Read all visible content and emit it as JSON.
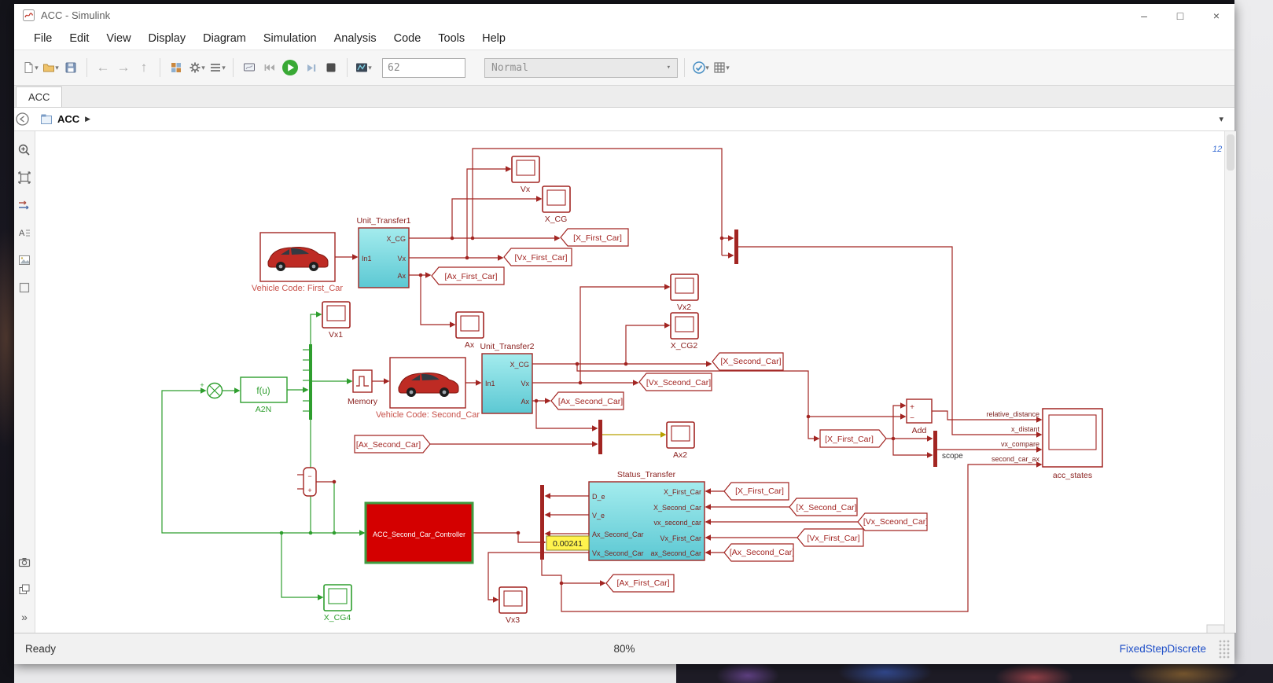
{
  "window": {
    "title": "ACC - Simulink",
    "controls": {
      "minimize": "–",
      "maximize": "□",
      "close": "×"
    }
  },
  "icons": {
    "caret": "▾",
    "crumb_arrow": "▶",
    "chevrons": "»"
  },
  "menu": {
    "items": [
      "File",
      "Edit",
      "View",
      "Display",
      "Diagram",
      "Simulation",
      "Analysis",
      "Code",
      "Tools",
      "Help"
    ]
  },
  "toolbar": {
    "stop_time": "62",
    "sim_mode": "Normal"
  },
  "tabs": {
    "model": "ACC"
  },
  "breadcrumb": {
    "model": "ACC"
  },
  "status": {
    "state": "Ready",
    "zoom": "80%",
    "solver": "FixedStepDiscrete"
  },
  "canvas": {
    "badge": "12"
  },
  "colors": {
    "wire_red": "#a22522",
    "wire_green": "#2e9e2e",
    "block_cyan": "#7adbe0",
    "controller_fill": "#d40000",
    "controller_border": "#3f9b3f",
    "display_yellow": "#fff34d",
    "solver_blue": "#1f4fc8"
  },
  "diagram": {
    "blocks": {
      "unit_transfer1": {
        "title": "Unit_Transfer1",
        "in1": "In1",
        "out1": "X_CG",
        "out2": "Vx",
        "out3": "Ax"
      },
      "unit_transfer2": {
        "title": "Unit_Transfer2",
        "in1": "In1",
        "out1": "X_CG",
        "out2": "Vx",
        "out3": "Ax"
      },
      "status_transfer": {
        "title": "Status_Transfer",
        "in1": "D_e",
        "in2": "V_e",
        "in3": "Ax_Second_Car",
        "in4": "Vx_Second_Car",
        "out1": "X_First_Car",
        "out2": "X_Second_Car",
        "out3": "vx_second_car",
        "out4": "Vx_First_Car",
        "out5": "ax_Second_Car"
      },
      "vehicle1": {
        "label": "Vehicle Code: First_Car"
      },
      "vehicle2": {
        "label": "Vehicle Code: Second_Car"
      },
      "controller": {
        "label": "ACC_Second_Car_Controller"
      },
      "memory": {
        "label": "Memory"
      },
      "fcn": {
        "text": "f(u)",
        "label": "A2N"
      },
      "sum_green": {
        "plus": "+"
      },
      "sum_red": {
        "minus": "−",
        "plus": "+"
      },
      "add": {
        "label": "Add",
        "plus": "+",
        "minus": "−"
      },
      "scope_bar": {
        "label": "scope"
      },
      "acc_states": {
        "label": "acc_states",
        "in1": "relative_distance",
        "in2": "x_distant",
        "in3": "vx_compare",
        "in4": "second_car_ax"
      },
      "display": {
        "value": "0.00241"
      }
    },
    "scopes": {
      "vx": "Vx",
      "x_cg": "X_CG",
      "vx1": "Vx1",
      "ax": "Ax",
      "vx2": "Vx2",
      "x_cg2": "X_CG2",
      "ax2": "Ax2",
      "vx3": "Vx3",
      "x_cg4": "X_CG4"
    },
    "tags": {
      "x_first": "[X_First_Car]",
      "vx_first": "[Vx_First_Car]",
      "ax_first": "[Ax_First_Car]",
      "x_second": "[X_Second_Car]",
      "vx_second": "[Vx_Sceond_Car]",
      "ax_second": "[Ax_Second_Car]"
    }
  }
}
